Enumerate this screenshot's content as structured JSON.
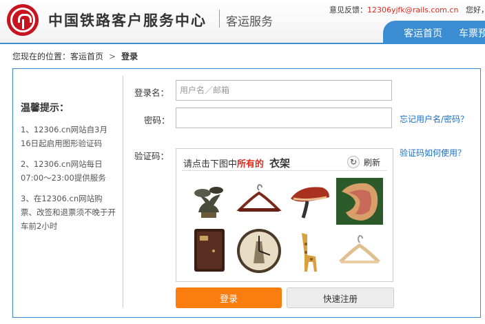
{
  "header": {
    "title": "中国铁路客户服务中心",
    "subtitle": "客运服务",
    "feedback_label": "意见反馈：",
    "feedback_email": "12306yjfk@rails.com.cn",
    "greeting": "您好，",
    "nav": [
      "客运首页",
      "车票预"
    ],
    "accent_color": "#3b8cd1"
  },
  "breadcrumb": {
    "prefix": "您现在的位置：",
    "home": "客运首页",
    "separator": ">",
    "current": "登录"
  },
  "tips": {
    "title": "温馨提示：",
    "items": [
      "1、12306.cn网站自3月16日起启用图形验证码",
      "2、12306.cn网站每日07:00～23:00提供服务",
      "3、在12306.cn网站购票、改签和退票须不晚于开车前2小时"
    ]
  },
  "form": {
    "username_label": "登录名：",
    "username_placeholder": "用户名／邮箱",
    "username_value": "",
    "password_label": "密码：",
    "password_value": "",
    "captcha_label": "验证码：",
    "forgot_link": "忘记用户名/密码？",
    "captcha_help_link": "验证码如何使用？"
  },
  "captcha": {
    "prompt_prefix": "请点击下图中",
    "prompt_highlight": "所有的",
    "prompt_item": "衣架",
    "refresh_label": "刷新",
    "images": [
      "mushroom-bonsai-icon",
      "hanger-icon",
      "mushroom-icon",
      "lingzhi-slice-icon",
      "safe-icon",
      "clock-icon",
      "giraffe-icon",
      "hanger-icon"
    ]
  },
  "buttons": {
    "login": "登录",
    "register": "快速注册",
    "login_color": "#fb7d0f"
  }
}
